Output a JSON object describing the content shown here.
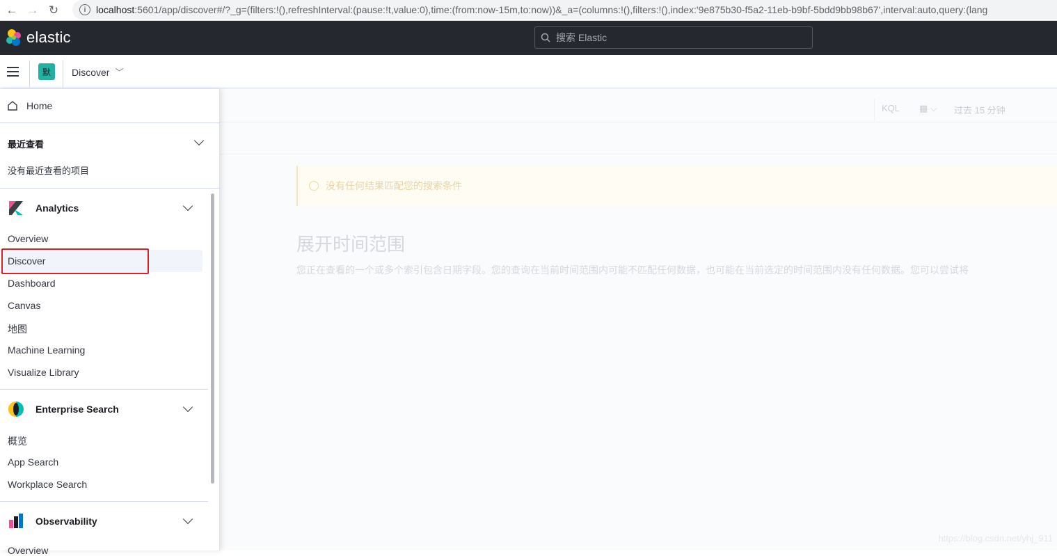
{
  "browser": {
    "back_icon": "←",
    "forward_icon": "→",
    "reload_icon": "↻",
    "url_host": "localhost",
    "url_rest": ":5601/app/discover#/?_g=(filters:!(),refreshInterval:(pause:!t,value:0),time:(from:now-15m,to:now))&_a=(columns:!(),filters:!(),index:'9e875b30-f5a2-11eb-b9bf-5bdd9bb98b67',interval:auto,query:(lang"
  },
  "header": {
    "logo_text": "elastic",
    "search_placeholder": "搜索 Elastic"
  },
  "subheader": {
    "space_initial": "默",
    "breadcrumb": "Discover"
  },
  "flyout": {
    "home_label": "Home",
    "recent": {
      "title": "最近查看",
      "empty_text": "没有最近查看的项目"
    },
    "analytics": {
      "title": "Analytics",
      "items": [
        "Overview",
        "Discover",
        "Dashboard",
        "Canvas",
        "地图",
        "Machine Learning",
        "Visualize Library"
      ]
    },
    "enterprise_search": {
      "title": "Enterprise Search",
      "items": [
        "概览",
        "App Search",
        "Workplace Search"
      ]
    },
    "observability": {
      "title": "Observability",
      "items": [
        "Overview"
      ]
    },
    "active_item": "Discover"
  },
  "main": {
    "kql_label": "KQL",
    "time_range": "过去 15 分钟",
    "callout_text": "没有任何结果匹配您的搜索条件",
    "expand_title": "展开时间范围",
    "expand_desc": "您正在查看的一个或多个索引包含日期字段。您的查询在当前时间范围内可能不匹配任何数据，也可能在当前选定的时间范围内没有任何数据。您可以尝试将"
  },
  "watermark": "https://blog.csdn.net/yhj_911",
  "colors": {
    "header_bg": "#25282f",
    "space_badge": "#20b2a2",
    "highlight_box": "#e02020"
  }
}
